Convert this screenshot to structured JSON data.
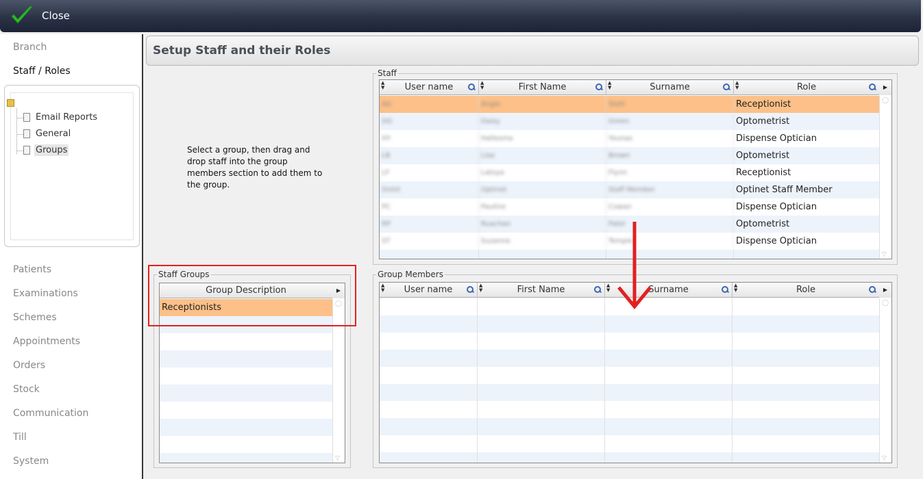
{
  "window": {
    "close_label": "Close"
  },
  "sidebar": {
    "top_items": [
      {
        "label": "Branch",
        "active": false
      },
      {
        "label": "Staff / Roles",
        "active": true
      }
    ],
    "tree": [
      {
        "label": "Email Reports",
        "selected": false
      },
      {
        "label": "General",
        "selected": false
      },
      {
        "label": "Groups",
        "selected": true
      }
    ],
    "bottom_items": [
      "Patients",
      "Examinations",
      "Schemes",
      "Appointments",
      "Orders",
      "Stock",
      "Communication",
      "Till",
      "System"
    ]
  },
  "page": {
    "title": "Setup Staff and their Roles",
    "instructions": "Select a group, then drag and drop staff into the group members section to add them to the group."
  },
  "staff": {
    "legend": "Staff",
    "columns": [
      "User name",
      "First Name",
      "Surname",
      "Role"
    ],
    "rows": [
      {
        "username": "AG",
        "first": "Angie",
        "surname": "Stott",
        "role": "Receptionist"
      },
      {
        "username": "DG",
        "first": "Daisy",
        "surname": "Green",
        "role": "Optometrist"
      },
      {
        "username": "HY",
        "first": "Hallesma",
        "surname": "Younas",
        "role": "Dispense Optician"
      },
      {
        "username": "LB",
        "first": "Lisa",
        "surname": "Brown",
        "role": "Optometrist"
      },
      {
        "username": "LF",
        "first": "Latoya",
        "surname": "Flynn",
        "role": "Receptionist"
      },
      {
        "username": "Onlnt",
        "first": "Optinet",
        "surname": "Staff Member",
        "role": "Optinet Staff Member"
      },
      {
        "username": "PC",
        "first": "Pauline",
        "surname": "Cowan",
        "role": "Dispense Optician"
      },
      {
        "username": "RP",
        "first": "Ruachan",
        "surname": "Patel",
        "role": "Optometrist"
      },
      {
        "username": "ST",
        "first": "Suzanne",
        "surname": "Temple",
        "role": "Dispense Optician"
      }
    ],
    "selected_index": 0
  },
  "staff_groups": {
    "legend": "Staff Groups",
    "column": "Group Description",
    "rows": [
      "Receptionists"
    ],
    "selected_index": 0
  },
  "group_members": {
    "legend": "Group Members",
    "columns": [
      "User name",
      "First Name",
      "Surname",
      "Role"
    ],
    "rows": []
  },
  "colors": {
    "selection": "#fdc088",
    "highlight": "#e22020",
    "alt_row": "#edf3fb"
  }
}
